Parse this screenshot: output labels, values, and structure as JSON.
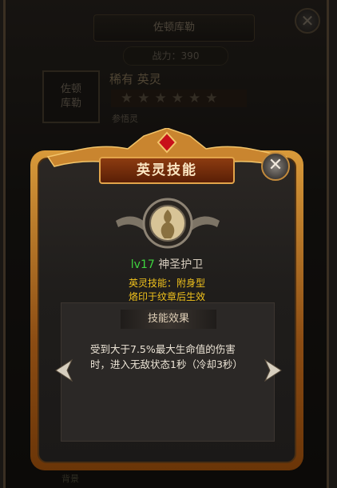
{
  "background": {
    "title": "佐顿库勒",
    "power": "战力：390",
    "portrait_label": "佐顿库勒",
    "rarity": "稀有  英灵",
    "stars": 6,
    "sub": "参悟灵",
    "bottom": "背景"
  },
  "popup": {
    "title": "英灵技能",
    "close_icon": "close-icon",
    "skill": {
      "icon": "winged-spirit-icon",
      "level": "lv17",
      "name": "神圣护卫",
      "type": "英灵技能：附身型",
      "condition": "烙印于纹章后生效"
    },
    "effect": {
      "title": "技能效果",
      "text": "受到大于7.5%最大生命值的伤害时，进入无敌状态1秒（冷却3秒）"
    },
    "nav": {
      "prev_icon": "arrow-left-icon",
      "next_icon": "arrow-right-icon"
    }
  },
  "colors": {
    "accent_gold": "#e2a44a",
    "level_green": "#3fd43f",
    "skill_yellow": "#f1c21c"
  }
}
